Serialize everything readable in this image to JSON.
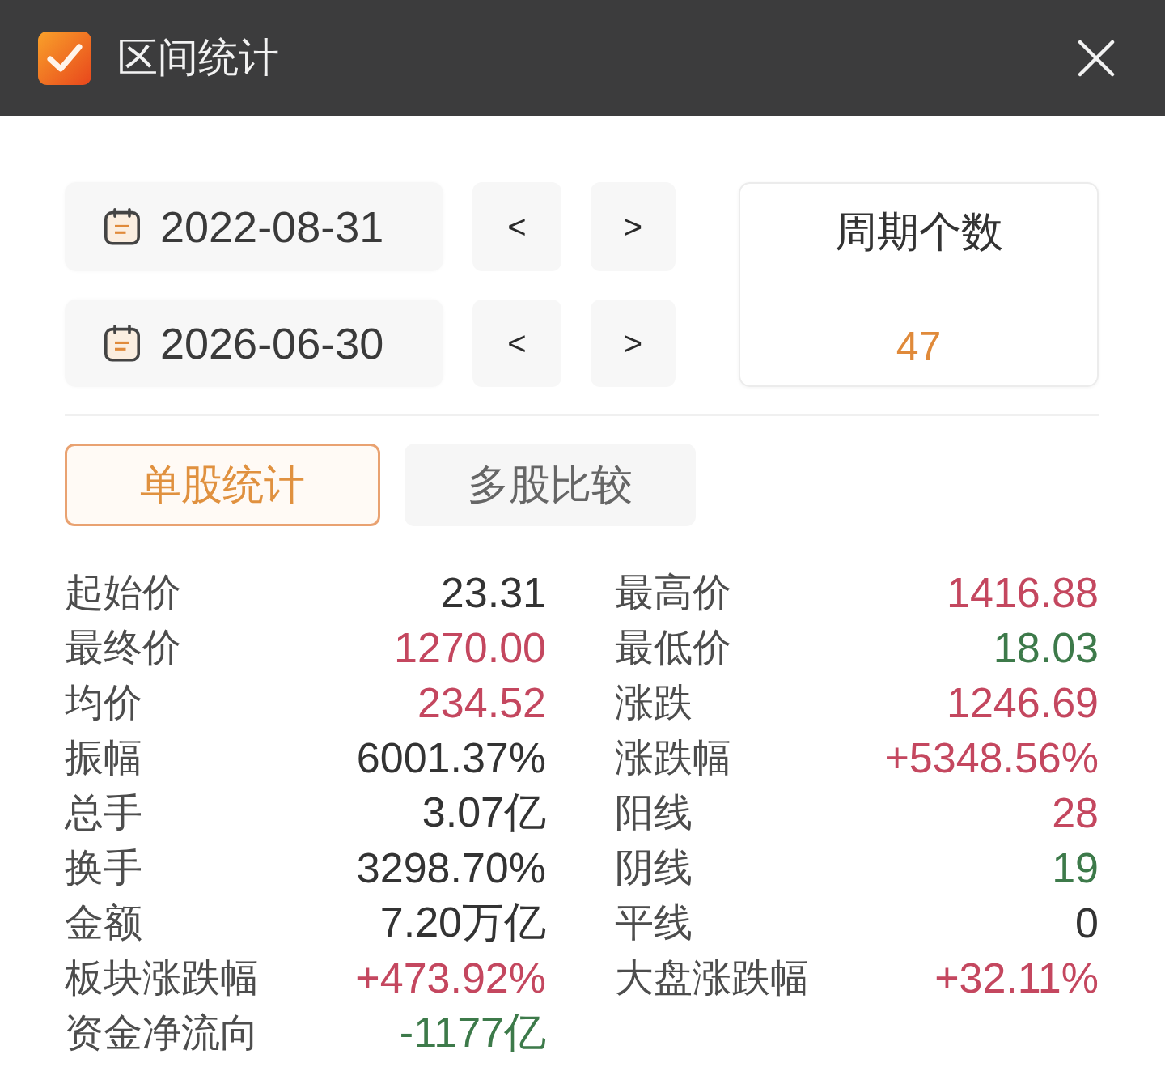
{
  "window": {
    "title": "区间统计"
  },
  "date_rows": [
    {
      "date": "2022-08-31",
      "prev": "<",
      "next": ">"
    },
    {
      "date": "2026-06-30",
      "prev": "<",
      "next": ">"
    }
  ],
  "period_count": {
    "label": "周期个数",
    "value": "47"
  },
  "tabs": [
    {
      "label": "单股统计",
      "selected": true
    },
    {
      "label": "多股比较",
      "selected": false
    }
  ],
  "stats": {
    "left": [
      {
        "label": "起始价",
        "value": "23.31",
        "color": "#333333"
      },
      {
        "label": "最终价",
        "value": "1270.00",
        "color": "#c4475f"
      },
      {
        "label": "均价",
        "value": "234.52",
        "color": "#c4475f"
      },
      {
        "label": "振幅",
        "value": "6001.37%",
        "color": "#333333"
      },
      {
        "label": "总手",
        "value": "3.07亿",
        "color": "#333333"
      },
      {
        "label": "换手",
        "value": "3298.70%",
        "color": "#333333"
      },
      {
        "label": "金额",
        "value": "7.20万亿",
        "color": "#333333"
      },
      {
        "label": "板块涨跌幅",
        "value": "+473.92%",
        "color": "#c4475f"
      },
      {
        "label": "资金净流向",
        "value": "-1177亿",
        "color": "#3d7a4a"
      }
    ],
    "right": [
      {
        "label": "最高价",
        "value": "1416.88",
        "color": "#c4475f"
      },
      {
        "label": "最低价",
        "value": "18.03",
        "color": "#3d7a4a"
      },
      {
        "label": "涨跌",
        "value": "1246.69",
        "color": "#c4475f"
      },
      {
        "label": "涨跌幅",
        "value": "+5348.56%",
        "color": "#c4475f"
      },
      {
        "label": "阳线",
        "value": "28",
        "color": "#c4475f"
      },
      {
        "label": "阴线",
        "value": "19",
        "color": "#3d7a4a"
      },
      {
        "label": "平线",
        "value": "0",
        "color": "#333333"
      },
      {
        "label": "大盘涨跌幅",
        "value": "+32.11%",
        "color": "#c4475f"
      }
    ]
  }
}
